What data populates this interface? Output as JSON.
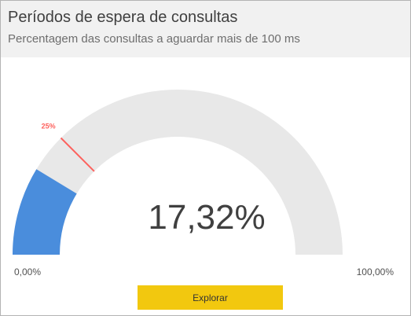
{
  "header": {
    "title": "Períodos de espera de consultas",
    "subtitle": "Percentagem das consultas a aguardar mais de 100 ms"
  },
  "gauge": {
    "value": 17.32,
    "min": 0,
    "max": 100,
    "target": 25,
    "value_label": "17,32%",
    "min_label": "0,00%",
    "max_label": "100,00%",
    "target_label": "25%",
    "colors": {
      "fill": "#4a8ddc",
      "track": "#e8e8e8",
      "target": "#fd625e",
      "header_bg": "#f1f1f1"
    }
  },
  "actions": {
    "explore_label": "Explorar"
  }
}
